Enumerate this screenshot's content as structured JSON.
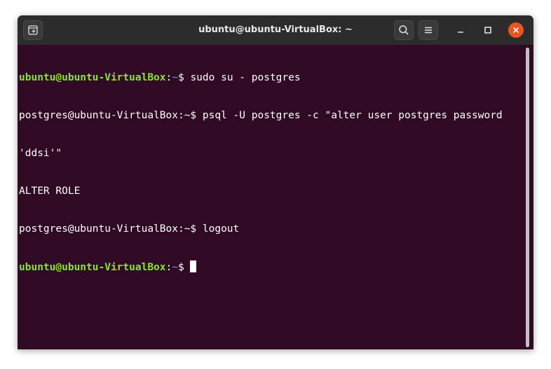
{
  "window": {
    "title": "ubuntu@ubuntu-VirtualBox: ~"
  },
  "icons": {
    "new_tab": "new-tab-icon",
    "search": "search-icon",
    "menu": "hamburger-menu-icon",
    "minimize": "minimize-icon",
    "maximize": "maximize-icon",
    "close": "close-icon"
  },
  "colors": {
    "terminal_bg": "#300a24",
    "titlebar_bg": "#2c2c2c",
    "prompt_user": "#8ae234",
    "prompt_path": "#729fcf",
    "close_button": "#e95420"
  },
  "terminal": {
    "lines": [
      {
        "type": "prompt",
        "user": "ubuntu@ubuntu-VirtualBox",
        "sep": ":",
        "path": "~",
        "symbol": "$ ",
        "command": "sudo su - postgres"
      },
      {
        "type": "plain",
        "text": "postgres@ubuntu-VirtualBox:~$ psql -U postgres -c \"alter user postgres password"
      },
      {
        "type": "plain",
        "text": "'ddsi'\""
      },
      {
        "type": "plain",
        "text": "ALTER ROLE"
      },
      {
        "type": "plain",
        "text": "postgres@ubuntu-VirtualBox:~$ logout"
      },
      {
        "type": "prompt",
        "user": "ubuntu@ubuntu-VirtualBox",
        "sep": ":",
        "path": "~",
        "symbol": "$ ",
        "command": ""
      }
    ]
  }
}
